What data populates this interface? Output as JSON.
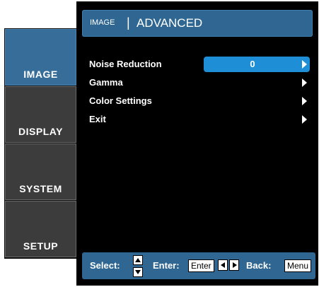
{
  "tabs": [
    {
      "label": "IMAGE",
      "active": true
    },
    {
      "label": "DISPLAY",
      "active": false
    },
    {
      "label": "SYSTEM",
      "active": false
    },
    {
      "label": "SETUP",
      "active": false
    }
  ],
  "header": {
    "section": "IMAGE",
    "separator": "|",
    "title": "ADVANCED"
  },
  "menu": [
    {
      "label": "Noise Reduction",
      "value": "0"
    },
    {
      "label": "Gamma"
    },
    {
      "label": "Color Settings"
    },
    {
      "label": "Exit"
    }
  ],
  "footer": {
    "select_label": "Select:",
    "enter_label": "Enter:",
    "enter_key": "Enter",
    "back_label": "Back:",
    "back_key": "Menu"
  },
  "colors": {
    "accent": "#2f6792",
    "active_tab": "#376e99",
    "highlight": "#1e8fd6"
  }
}
